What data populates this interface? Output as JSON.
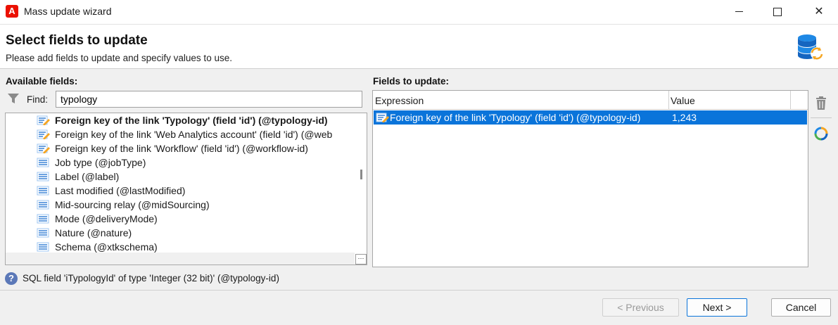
{
  "window": {
    "title": "Mass update wizard",
    "app_icon_letter": "A"
  },
  "header": {
    "title": "Select fields to update",
    "subtitle": "Please add fields to update and specify values to use."
  },
  "available": {
    "label": "Available fields:",
    "find_label": "Find:",
    "find_value": "typology",
    "items": [
      {
        "label": "Foreign key of the link 'Typology' (field 'id') (@typology-id)",
        "icon": "foreign-key-icon",
        "bold": true
      },
      {
        "label": "Foreign key of the link 'Web Analytics account' (field 'id') (@web",
        "icon": "foreign-key-icon",
        "bold": false
      },
      {
        "label": "Foreign key of the link 'Workflow' (field 'id') (@workflow-id)",
        "icon": "foreign-key-icon",
        "bold": false
      },
      {
        "label": "Job type (@jobType)",
        "icon": "field-icon",
        "bold": false
      },
      {
        "label": "Label (@label)",
        "icon": "field-icon",
        "bold": false
      },
      {
        "label": "Last modified (@lastModified)",
        "icon": "field-icon",
        "bold": false
      },
      {
        "label": "Mid-sourcing relay (@midSourcing)",
        "icon": "field-icon",
        "bold": false
      },
      {
        "label": "Mode (@deliveryMode)",
        "icon": "field-icon",
        "bold": false
      },
      {
        "label": "Nature (@nature)",
        "icon": "field-icon",
        "bold": false
      },
      {
        "label": "Schema (@xtkschema)",
        "icon": "field-icon",
        "bold": false
      }
    ]
  },
  "update": {
    "label": "Fields to update:",
    "columns": {
      "expression": "Expression",
      "value": "Value"
    },
    "rows": [
      {
        "expression": "Foreign key of the link 'Typology' (field 'id') (@typology-id)",
        "value": "1,243",
        "icon": "foreign-key-icon"
      }
    ]
  },
  "info": {
    "text": "SQL field 'iTypologyId' of type 'Integer (32 bit)' (@typology-id)"
  },
  "buttons": {
    "previous": "< Previous",
    "next": "Next >",
    "cancel": "Cancel"
  },
  "colors": {
    "selection": "#0a74da",
    "app_icon": "#eb1000",
    "db_icon_blue": "#1e88e5",
    "refresh_orange": "#f5a623"
  }
}
